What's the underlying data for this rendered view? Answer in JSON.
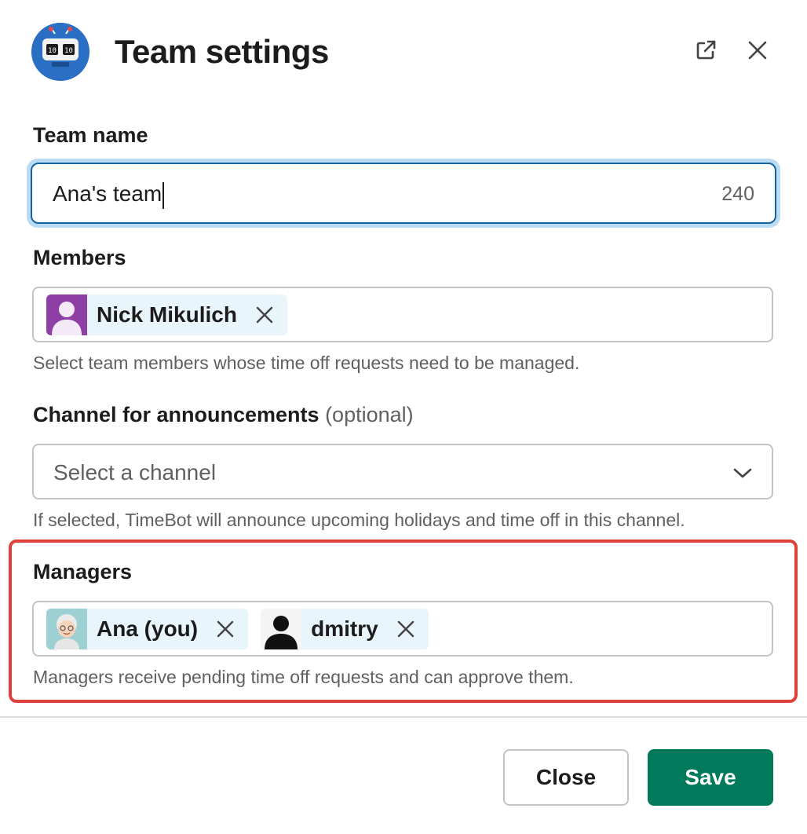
{
  "header": {
    "title": "Team settings",
    "icons": {
      "logo": "robot-clock-icon",
      "popout": "external-link-icon",
      "close": "close-icon"
    }
  },
  "team_name": {
    "label": "Team name",
    "value": "Ana's team",
    "counter": "240"
  },
  "members": {
    "label": "Members",
    "chips": [
      {
        "name": "Nick Mikulich",
        "avatar": "user-silhouette-purple"
      }
    ],
    "hint": "Select team members whose time off requests need to be managed."
  },
  "channel": {
    "label": "Channel for announcements",
    "optional_label": "(optional)",
    "placeholder": "Select a channel",
    "hint": "If selected, TimeBot will announce upcoming holidays and time off in this channel."
  },
  "managers": {
    "label": "Managers",
    "chips": [
      {
        "name": "Ana (you)",
        "avatar": "grandma-emoji"
      },
      {
        "name": "dmitry",
        "avatar": "user-silhouette-black"
      }
    ],
    "hint": "Managers receive pending time off requests and can approve them."
  },
  "footer": {
    "close_label": "Close",
    "save_label": "Save"
  },
  "colors": {
    "primary_text": "#1d1c1d",
    "secondary_text": "#616061",
    "focus_blue": "#1264a3",
    "chip_bg": "#e8f5fa",
    "save_green": "#007a5a",
    "highlight_red": "#e0403a"
  }
}
